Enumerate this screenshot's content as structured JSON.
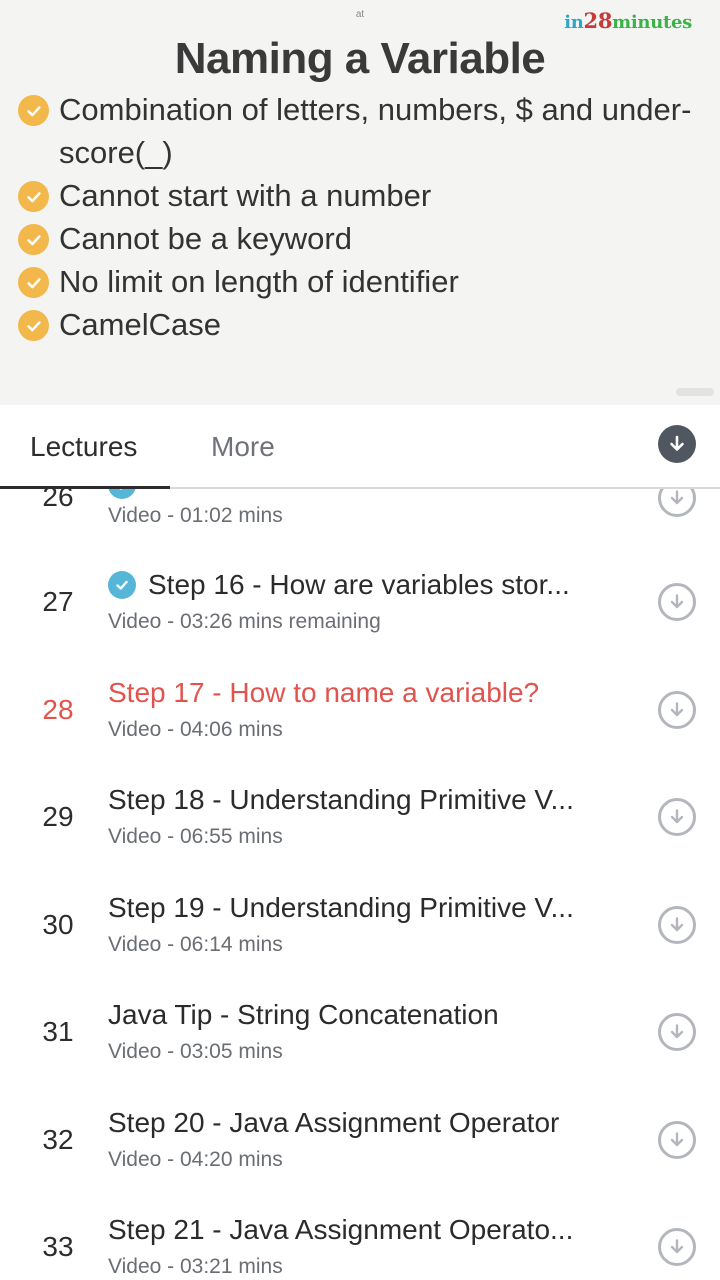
{
  "slide": {
    "top_small_text": "at",
    "logo": {
      "part1": "in",
      "part2": "28",
      "part3": "minutes"
    },
    "title": "Naming a Variable",
    "bullets": [
      "Combination of letters, numbers, $ and under-score(_)",
      "Cannot start with a number",
      "Cannot be a keyword",
      "No limit on length of identifier",
      "CamelCase"
    ],
    "bullet_icon": "check-circle-icon",
    "bullet_color": "#f2b84b"
  },
  "tabs": {
    "lectures": "Lectures",
    "more": "More",
    "download_all_icon": "download-circle-icon"
  },
  "lectures": [
    {
      "number": "26",
      "title": "",
      "subtitle": "Video - 01:02 mins",
      "completed": true
    },
    {
      "number": "27",
      "title": "Step 16 - How are variables stor...",
      "subtitle": "Video - 03:26 mins remaining",
      "completed": true
    },
    {
      "number": "28",
      "title": "Step 17 - How to name a variable?",
      "subtitle": "Video - 04:06 mins",
      "completed": false,
      "active": true
    },
    {
      "number": "29",
      "title": "Step 18 - Understanding Primitive V...",
      "subtitle": "Video - 06:55 mins",
      "completed": false
    },
    {
      "number": "30",
      "title": "Step 19 - Understanding Primitive V...",
      "subtitle": "Video - 06:14 mins",
      "completed": false
    },
    {
      "number": "31",
      "title": "Java Tip - String Concatenation",
      "subtitle": "Video - 03:05 mins",
      "completed": false
    },
    {
      "number": "32",
      "title": "Step 20 - Java Assignment Operator",
      "subtitle": "Video - 04:20 mins",
      "completed": false
    },
    {
      "number": "33",
      "title": "Step 21 - Java Assignment Operato...",
      "subtitle": "Video - 03:21 mins",
      "completed": false
    }
  ],
  "colors": {
    "active": "#e0544d",
    "completed_badge": "#56b6d8",
    "download_outline": "#b3b7bd"
  }
}
